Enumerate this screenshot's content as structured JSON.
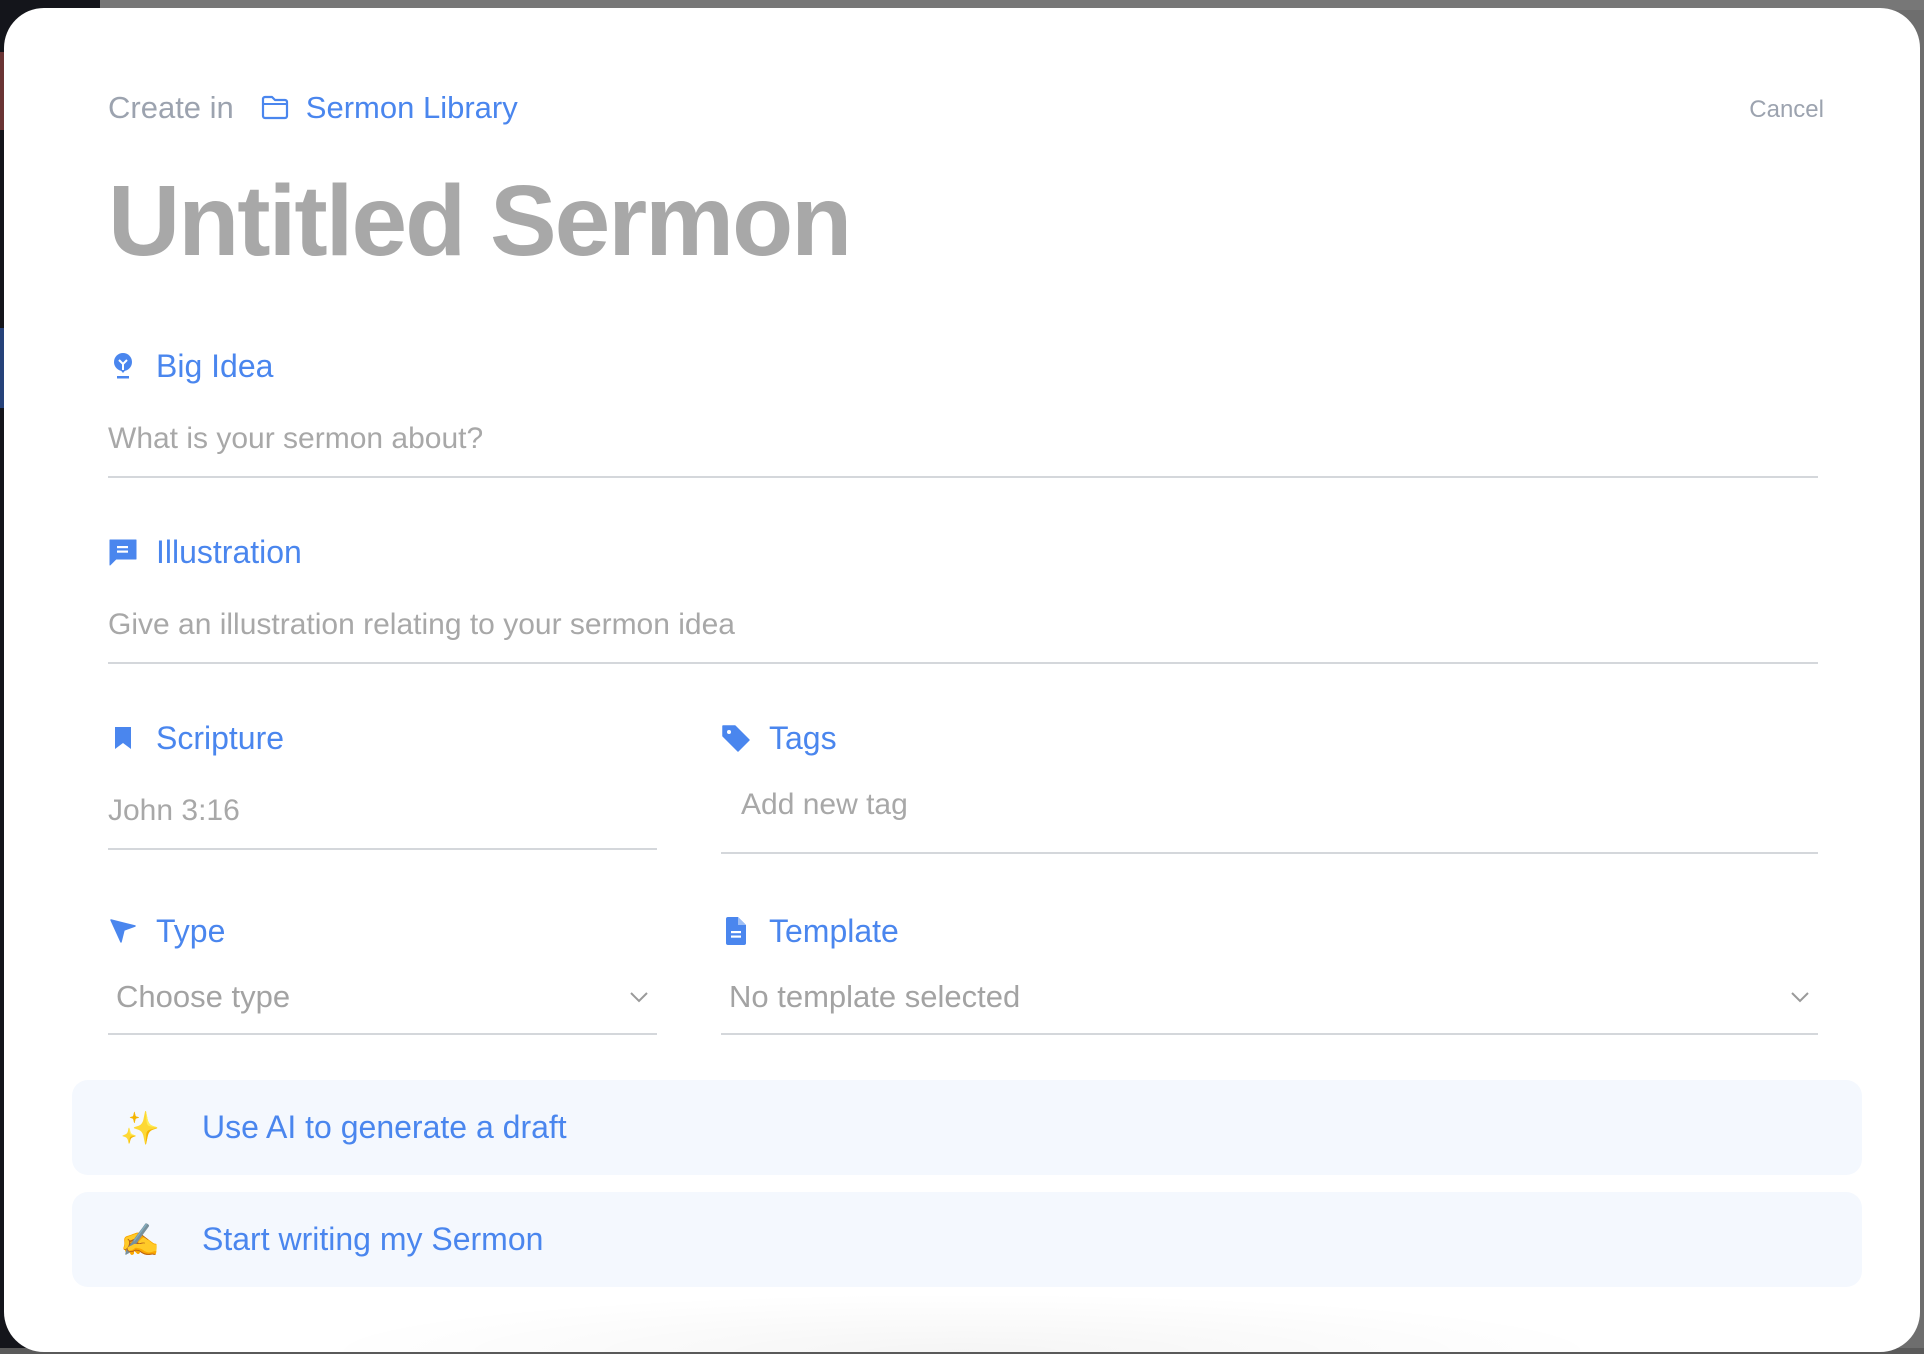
{
  "header": {
    "create_in_label": "Create in",
    "folder_icon": "folder-icon",
    "folder_name": "Sermon Library",
    "cancel_label": "Cancel"
  },
  "title": "Untitled Sermon",
  "fields": {
    "big_idea": {
      "icon": "lightbulb-icon",
      "label": "Big Idea",
      "value": "",
      "placeholder": "What is your sermon about?"
    },
    "illustration": {
      "icon": "chat-bubble-icon",
      "label": "Illustration",
      "value": "",
      "placeholder": "Give an illustration relating to your sermon idea"
    },
    "scripture": {
      "icon": "bookmark-icon",
      "label": "Scripture",
      "value": "",
      "placeholder": "John 3:16"
    },
    "tags": {
      "icon": "tag-icon",
      "label": "Tags",
      "value": "",
      "placeholder": "Add new tag"
    },
    "type": {
      "icon": "cursor-arrow-icon",
      "label": "Type",
      "selected": "Choose type"
    },
    "template": {
      "icon": "document-icon",
      "label": "Template",
      "selected": "No template selected"
    }
  },
  "actions": [
    {
      "icon": "sparkles-icon",
      "emoji": "✨",
      "label": "Use AI to generate a draft"
    },
    {
      "icon": "writing-hand-icon",
      "emoji": "✍️",
      "label": "Start writing my Sermon"
    }
  ],
  "colors": {
    "accent": "#4a86ee",
    "muted_text": "#9ca3af",
    "placeholder": "#a8a8a8",
    "divider": "#d4d7db",
    "button_bg": "#f4f8fe"
  }
}
